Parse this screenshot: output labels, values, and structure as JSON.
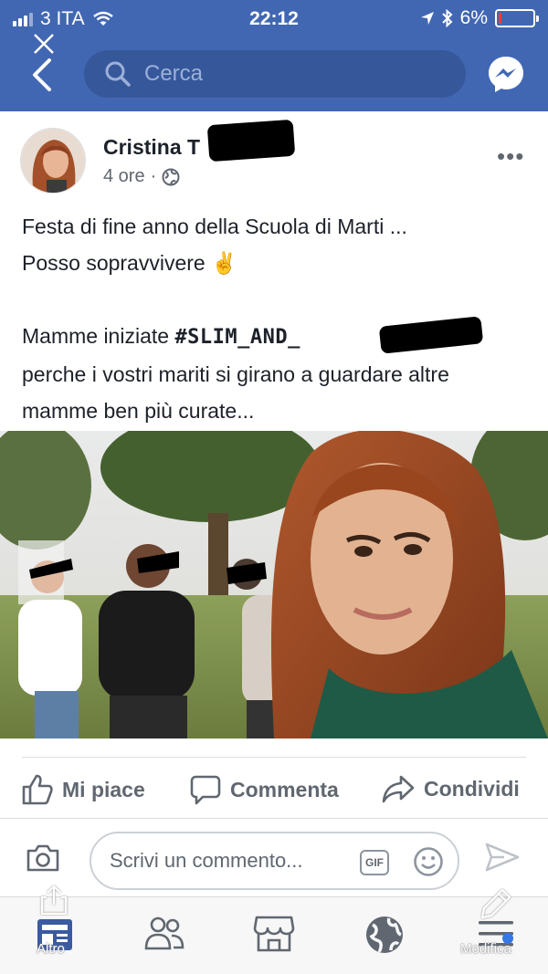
{
  "status": {
    "carrier": "3 ITA",
    "time": "22:12",
    "battery": "6%",
    "battery_level": 0.06
  },
  "search": {
    "placeholder": "Cerca"
  },
  "post": {
    "author": "Cristina T",
    "time": "4 ore",
    "text": {
      "line1": "Festa di fine anno della Scuola di Marti ...",
      "line2": "Posso sopravvivere",
      "line2_emoji": "✌️",
      "line3_prefix": "Mamme iniziate ",
      "hashtag": "#SLIM_AND_",
      "line4": "perche i vostri mariti si girano a guardare altre",
      "line5": "mamme ben più  curate..."
    }
  },
  "actions": {
    "like": "Mi piace",
    "comment": "Commenta",
    "share": "Condividi"
  },
  "comment_box": {
    "placeholder": "Scrivi un commento...",
    "gif": "GIF"
  },
  "overlay": {
    "left": "Altro",
    "right": "Modifica"
  },
  "colors": {
    "brand": "#4267b2",
    "search_bg": "#36589b",
    "text": "#1d2129",
    "muted": "#606770"
  },
  "icons": [
    "back-icon",
    "close-icon",
    "search-icon",
    "messenger-icon",
    "globe-icon",
    "more-icon",
    "like-icon",
    "comment-icon",
    "share-icon",
    "camera-icon",
    "gif-icon",
    "emoji-icon",
    "send-icon",
    "feed-icon",
    "friends-icon",
    "marketplace-icon",
    "globe-tab-icon",
    "menu-icon"
  ]
}
